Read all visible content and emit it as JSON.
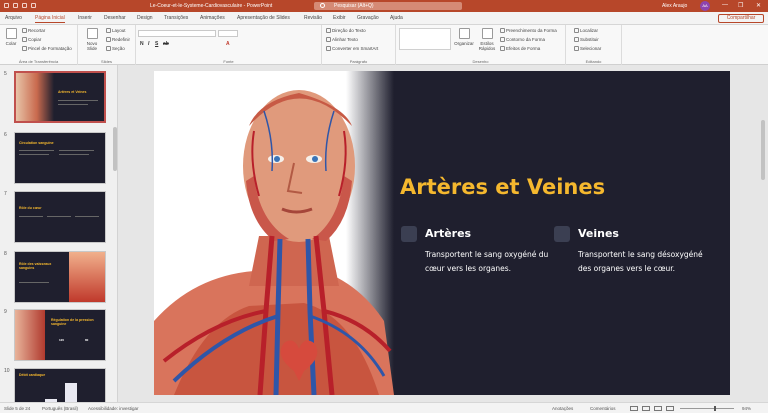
{
  "app": {
    "doc_title": "Le-Coeur-et-le-Systeme-Cardiovasculaire  -  PowerPoint",
    "search_placeholder": "Pesquisar (Alt+Q)",
    "user_name": "Alex Araujo",
    "user_initials": "AA",
    "minimize": "—",
    "restore": "❐",
    "close": "✕"
  },
  "tabs": [
    "Arquivo",
    "Página Inicial",
    "Inserir",
    "Desenhar",
    "Design",
    "Transições",
    "Animações",
    "Apresentação de Slides",
    "Revisão",
    "Exibir",
    "Gravação",
    "Ajuda"
  ],
  "share_label": "Compartilhar",
  "ribbon": {
    "clipboard": {
      "paste": "Colar",
      "cut": "Recortar",
      "copy": "Copiar",
      "format_painter": "Pincel de Formatação",
      "label": "Área de Transferência"
    },
    "slides": {
      "new_slide": "Novo Slide",
      "layout": "Layout",
      "reset": "Redefinir",
      "section": "Seção",
      "label": "Slides"
    },
    "font": {
      "label": "Fonte",
      "bold": "N",
      "italic": "I",
      "underline": "S",
      "strike": "ab",
      "font_color": "A"
    },
    "paragraph": {
      "text_direction": "Direção do Texto",
      "align_text": "Alinhar Texto",
      "smartart": "Converter em SmartArt",
      "label": "Parágrafo"
    },
    "drawing": {
      "arrange": "Organizar",
      "quick_styles": "Estilos Rápidos",
      "shape_fill": "Preenchimento da Forma",
      "shape_outline": "Contorno da Forma",
      "shape_effects": "Efeitos de Forma",
      "label": "Desenho"
    },
    "editing": {
      "find": "Localizar",
      "replace": "Substituir",
      "select": "Selecionar",
      "label": "Editando"
    }
  },
  "thumbnails": [
    {
      "num": "5",
      "title": "Artères et Veines",
      "selected": true
    },
    {
      "num": "6",
      "title": "Circulation sanguine",
      "selected": false
    },
    {
      "num": "7",
      "title": "Rôle du cœur",
      "selected": false
    },
    {
      "num": "8",
      "title": "Rôle des vaisseaux sanguins",
      "selected": false
    },
    {
      "num": "9",
      "title": "Régulation de la pression sanguine",
      "selected": false,
      "v1": "120",
      "v2": "80"
    },
    {
      "num": "10",
      "title": "Débit cardiaque",
      "selected": false
    }
  ],
  "slide": {
    "title": "Artères et Veines",
    "col1": {
      "heading": "Artères",
      "body": "Transportent le sang oxygéné du cœur vers les organes."
    },
    "col2": {
      "heading": "Veines",
      "body": "Transportent le sang désoxygéné des organes vers le cœur."
    }
  },
  "status": {
    "slide_of": "Slide 5 de 24",
    "language": "Português (Brasil)",
    "accessibility": "Acessibilidade: investigar",
    "notes": "Anotações",
    "comments": "Comentários",
    "zoom": "94%"
  },
  "colors": {
    "accent": "#b7472a",
    "slide_bg": "#1f1f2e",
    "title_gold": "#f5b82e"
  }
}
